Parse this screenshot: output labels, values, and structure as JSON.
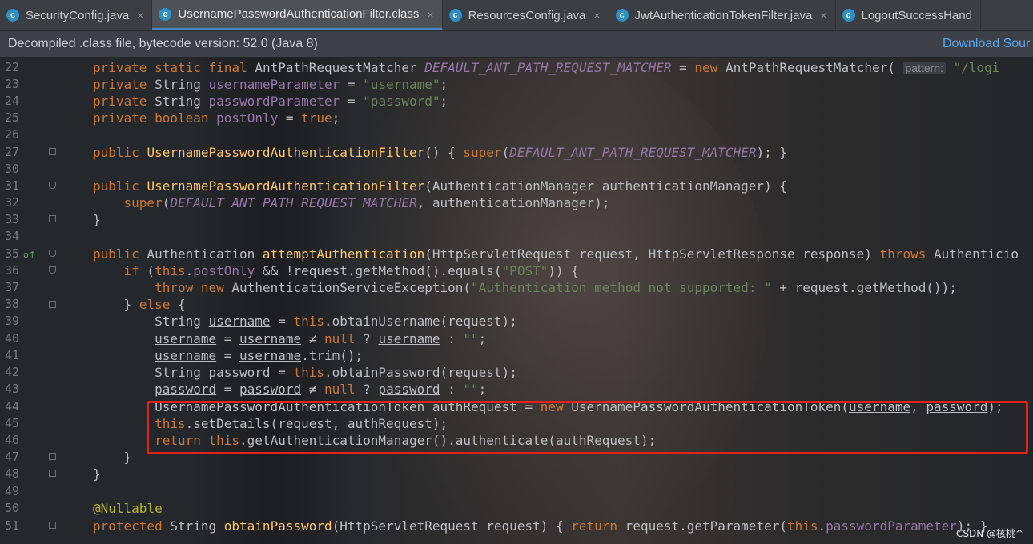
{
  "tabs": [
    {
      "label": "SecurityConfig.java",
      "icon": "class-icon",
      "active": false,
      "closable": true
    },
    {
      "label": "UsernamePasswordAuthenticationFilter.class",
      "icon": "class-icon",
      "active": true,
      "closable": true
    },
    {
      "label": "ResourcesConfig.java",
      "icon": "class-icon",
      "active": false,
      "closable": true
    },
    {
      "label": "JwtAuthenticationTokenFilter.java",
      "icon": "class-icon",
      "active": false,
      "closable": true
    },
    {
      "label": "LogoutSuccessHand",
      "icon": "class-icon",
      "active": false,
      "closable": false
    }
  ],
  "tab_icon_glyph": "c",
  "close_glyph": "×",
  "banner": {
    "message": "Decompiled .class file, bytecode version: 52.0 (Java 8)",
    "action": "Download Sour"
  },
  "editor": {
    "line_numbers": [
      "22",
      "23",
      "24",
      "25",
      "26",
      "27",
      "30",
      "31",
      "32",
      "33",
      "34",
      "35",
      "36",
      "37",
      "38",
      "39",
      "40",
      "41",
      "42",
      "43",
      "44",
      "45",
      "46",
      "47",
      "48",
      "49",
      "50",
      "51"
    ],
    "lines": [
      "private static final AntPathRequestMatcher DEFAULT_ANT_PATH_REQUEST_MATCHER = new AntPathRequestMatcher( pattern: \"/logi",
      "private String usernameParameter = \"username\";",
      "private String passwordParameter = \"password\";",
      "private boolean postOnly = true;",
      "",
      "public UsernamePasswordAuthenticationFilter() { super(DEFAULT_ANT_PATH_REQUEST_MATCHER); }",
      "",
      "public UsernamePasswordAuthenticationFilter(AuthenticationManager authenticationManager) {",
      "    super(DEFAULT_ANT_PATH_REQUEST_MATCHER, authenticationManager);",
      "}",
      "",
      "public Authentication attemptAuthentication(HttpServletRequest request, HttpServletResponse response) throws Authenticio",
      "    if (this.postOnly && !request.getMethod().equals(\"POST\")) {",
      "        throw new AuthenticationServiceException(\"Authentication method not supported: \" + request.getMethod());",
      "    } else {",
      "        String username = this.obtainUsername(request);",
      "        username = username ≠ null ? username : \"\";",
      "        username = username.trim();",
      "        String password = this.obtainPassword(request);",
      "        password = password ≠ null ? password : \"\";",
      "        UsernamePasswordAuthenticationToken authRequest = new UsernamePasswordAuthenticationToken(username, password);",
      "        this.setDetails(request, authRequest);",
      "        return this.getAuthenticationManager().authenticate(authRequest);",
      "    }",
      "}",
      "",
      "@Nullable",
      "protected String obtainPassword(HttpServletRequest request) { return request.getParameter(this.passwordParameter); }"
    ],
    "override_marker": "o↑"
  },
  "watermark": "CSDN @核桃^",
  "colors": {
    "keyword": "#cc7832",
    "method": "#ffc66d",
    "string": "#6a8759",
    "field": "#9876aa",
    "highlight_box": "#e3221b",
    "link": "#5aa7f0"
  }
}
